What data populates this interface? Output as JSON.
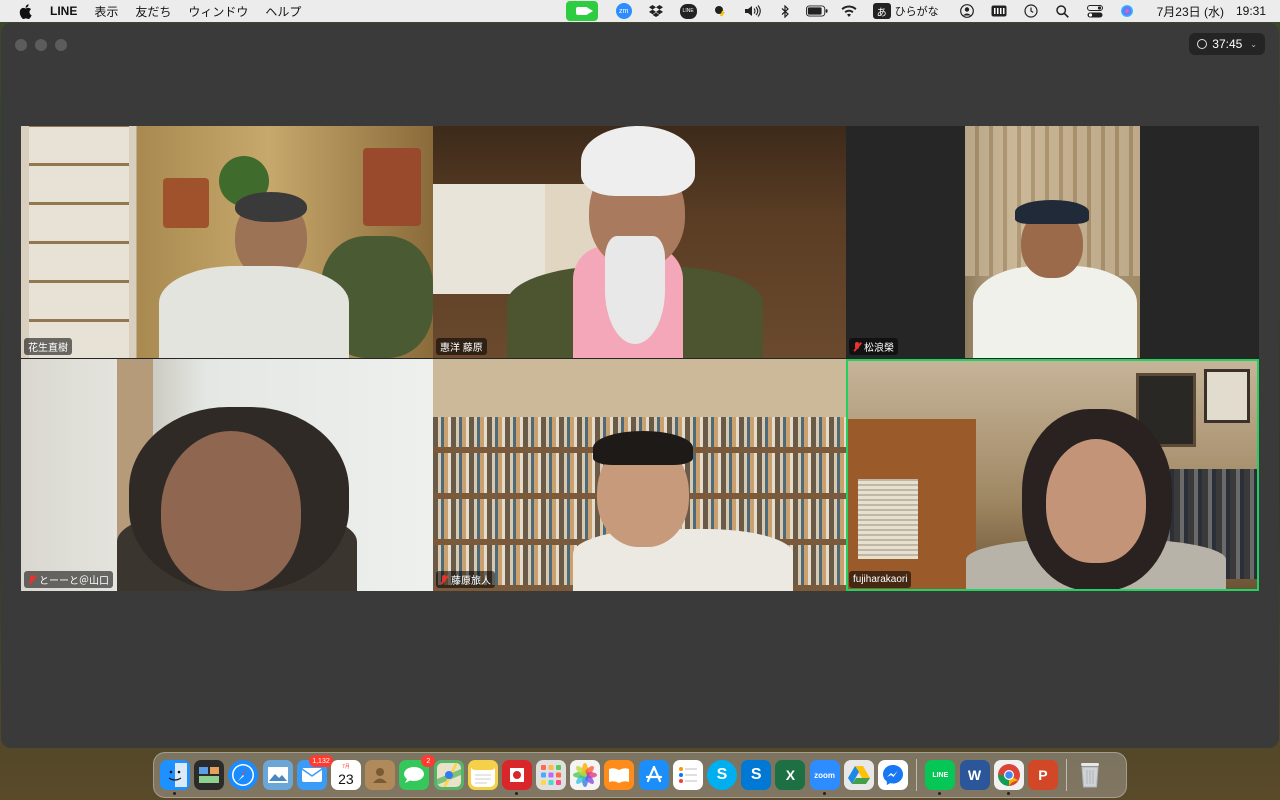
{
  "menubar": {
    "app_name": "LINE",
    "menus": [
      "表示",
      "友だち",
      "ウィンドウ",
      "ヘルプ"
    ],
    "ime_badge": "あ",
    "ime_label": "ひらがな",
    "zm_label": "zm",
    "line_label": "LINE",
    "date": "7月23日 (水)",
    "time": "19:31"
  },
  "meeting": {
    "timer": "37:45",
    "participants": [
      {
        "name": "花生直樹",
        "muted": false
      },
      {
        "name": "惠洋 藤原",
        "muted": false
      },
      {
        "name": "松浪榮",
        "muted": true
      },
      {
        "name": "とーーと＠山口",
        "muted": true
      },
      {
        "name": "藤原旅人",
        "muted": true
      },
      {
        "name": "fujiharakaori",
        "muted": false,
        "active_speaker": true
      }
    ]
  },
  "dock": {
    "apps": [
      {
        "name": "Finder",
        "color": "#1e90ff",
        "running": true
      },
      {
        "name": "Mission Control",
        "color": "#2b2b2b"
      },
      {
        "name": "Safari",
        "color": "#1a8cff"
      },
      {
        "name": "Preview",
        "color": "#6aa7d8"
      },
      {
        "name": "Mail",
        "color": "#3b9cf7",
        "badge": "1,132"
      },
      {
        "name": "Calendar",
        "color": "#ffffff",
        "label": "23",
        "sub": "7月"
      },
      {
        "name": "Contacts",
        "color": "#b08a5a"
      },
      {
        "name": "Messages",
        "color": "#34c759",
        "badge": "2"
      },
      {
        "name": "Maps",
        "color": "#58b368"
      },
      {
        "name": "Notes",
        "color": "#f5d14a"
      },
      {
        "name": "Photo Booth",
        "color": "#d9262b",
        "running": true
      },
      {
        "name": "Launchpad",
        "color": "#e0e0e0"
      },
      {
        "name": "Photos",
        "color": "#f4f4f4"
      },
      {
        "name": "Books",
        "color": "#ff8c1a"
      },
      {
        "name": "App Store",
        "color": "#1c8ef9"
      },
      {
        "name": "Reminders",
        "color": "#ffffff"
      },
      {
        "name": "Skype",
        "color": "#00aff0",
        "label": "S"
      },
      {
        "name": "Skype Blue",
        "color": "#0078d4",
        "label": "S"
      },
      {
        "name": "Excel",
        "color": "#1d7044",
        "label": "X"
      },
      {
        "name": "Zoom",
        "color": "#2d8cff",
        "label": "zoom",
        "running": true
      },
      {
        "name": "Google Drive",
        "color": "#e8e8e8"
      },
      {
        "name": "Messenger",
        "color": "#1877f2"
      },
      {
        "name": "LINE",
        "color": "#06c755",
        "label": "LINE",
        "running": true
      },
      {
        "name": "Word",
        "color": "#2b579a",
        "label": "W"
      },
      {
        "name": "Chrome",
        "color": "#f1f1f1",
        "running": true
      },
      {
        "name": "PowerPoint",
        "color": "#d24726",
        "label": "P"
      },
      {
        "name": "Trash",
        "color": "#cfd3d6"
      }
    ]
  }
}
